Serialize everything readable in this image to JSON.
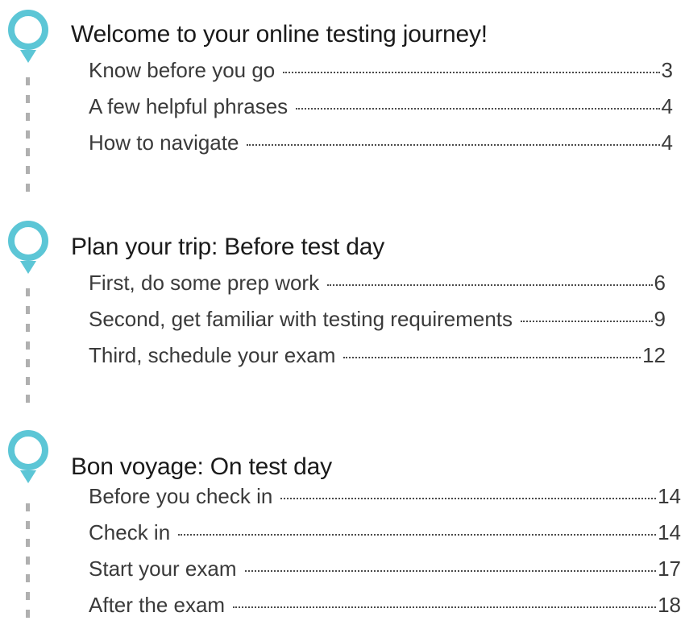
{
  "colors": {
    "pin": "#5cc6d6",
    "dash": "#b0b0b0",
    "text": "#1a1a1a",
    "entry_text": "#3a3a3a"
  },
  "sections": [
    {
      "icon": "map-pin-icon",
      "title": "Welcome to your online testing journey!",
      "entries": [
        {
          "label": "Know before you go",
          "page": "3"
        },
        {
          "label": "A few helpful phrases",
          "page": "4"
        },
        {
          "label": "How to navigate",
          "page": "4"
        }
      ]
    },
    {
      "icon": "map-pin-icon",
      "title": "Plan your trip: Before test day",
      "entries": [
        {
          "label": "First, do some prep work",
          "page": "6"
        },
        {
          "label": "Second, get familiar with testing requirements",
          "page": "9"
        },
        {
          "label": "Third, schedule your exam",
          "page": "12"
        }
      ]
    },
    {
      "icon": "map-pin-icon",
      "title": "Bon voyage: On test day",
      "entries": [
        {
          "label": "Before you check in",
          "page": "14"
        },
        {
          "label": "Check in",
          "page": "14"
        },
        {
          "label": "Start your exam",
          "page": "17"
        },
        {
          "label": "After the exam",
          "page": "18"
        }
      ]
    }
  ]
}
